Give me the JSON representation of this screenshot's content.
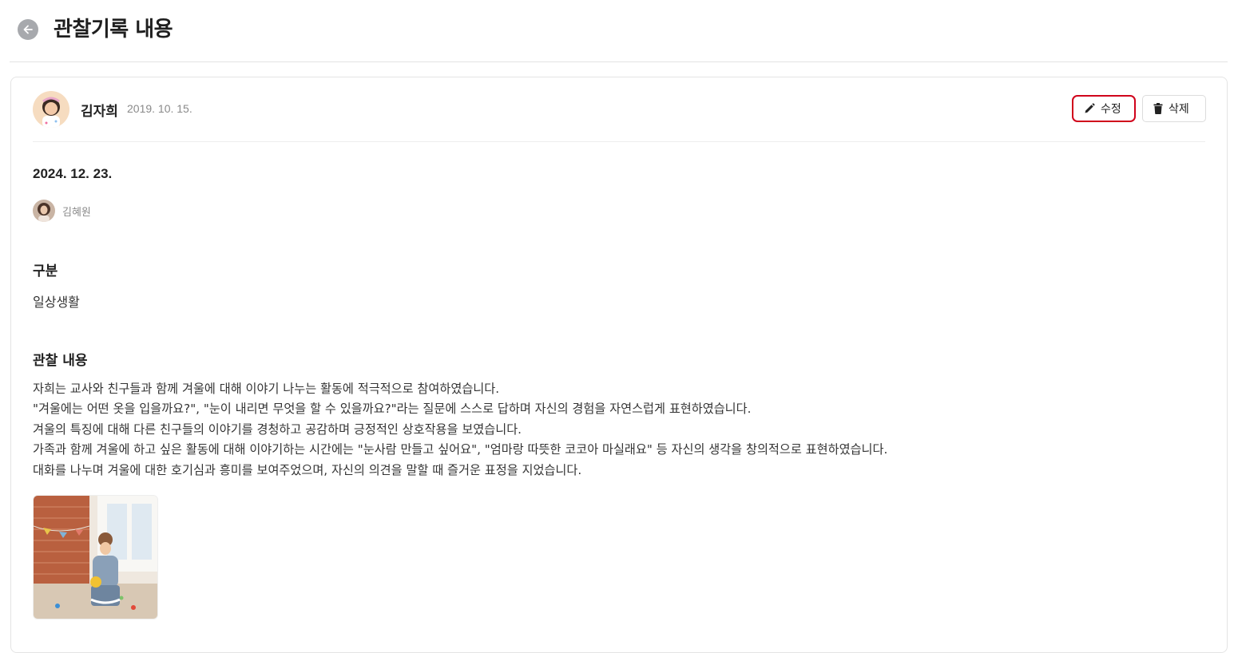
{
  "header": {
    "title": "관찰기록 내용"
  },
  "child": {
    "name": "김자희",
    "birth_date": "2019. 10. 15."
  },
  "actions": {
    "edit_label": "수정",
    "delete_label": "삭제"
  },
  "record": {
    "date": "2024. 12. 23.",
    "teacher_name": "김혜원",
    "category_label": "구분",
    "category_value": "일상생활",
    "content_label": "관찰 내용",
    "content_lines": [
      "자희는 교사와 친구들과 함께 겨울에 대해 이야기 나누는 활동에 적극적으로 참여하였습니다.",
      "\"겨울에는 어떤 옷을 입을까요?\", \"눈이 내리면 무엇을 할 수 있을까요?\"라는 질문에 스스로 답하며 자신의 경험을 자연스럽게 표현하였습니다.",
      "겨울의 특징에 대해 다른 친구들의 이야기를 경청하고 공감하며 긍정적인 상호작용을 보였습니다.",
      "가족과 함께 겨울에 하고 싶은 활동에 대해 이야기하는 시간에는 \"눈사람 만들고 싶어요\", \"엄마랑 따뜻한 코코아 마실래요\" 등 자신의 생각을 창의적으로 표현하였습니다.",
      "대화를 나누며 겨울에 대한 호기심과 흥미를 보여주었으며, 자신의 의견을 말할 때 즐거운 표정을 지었습니다."
    ]
  },
  "icons": {
    "back": "arrow-left-icon",
    "edit": "pencil-icon",
    "delete": "trash-icon"
  },
  "colors": {
    "edit_highlight": "#d0021b",
    "back_button": "#a7a9ad"
  }
}
